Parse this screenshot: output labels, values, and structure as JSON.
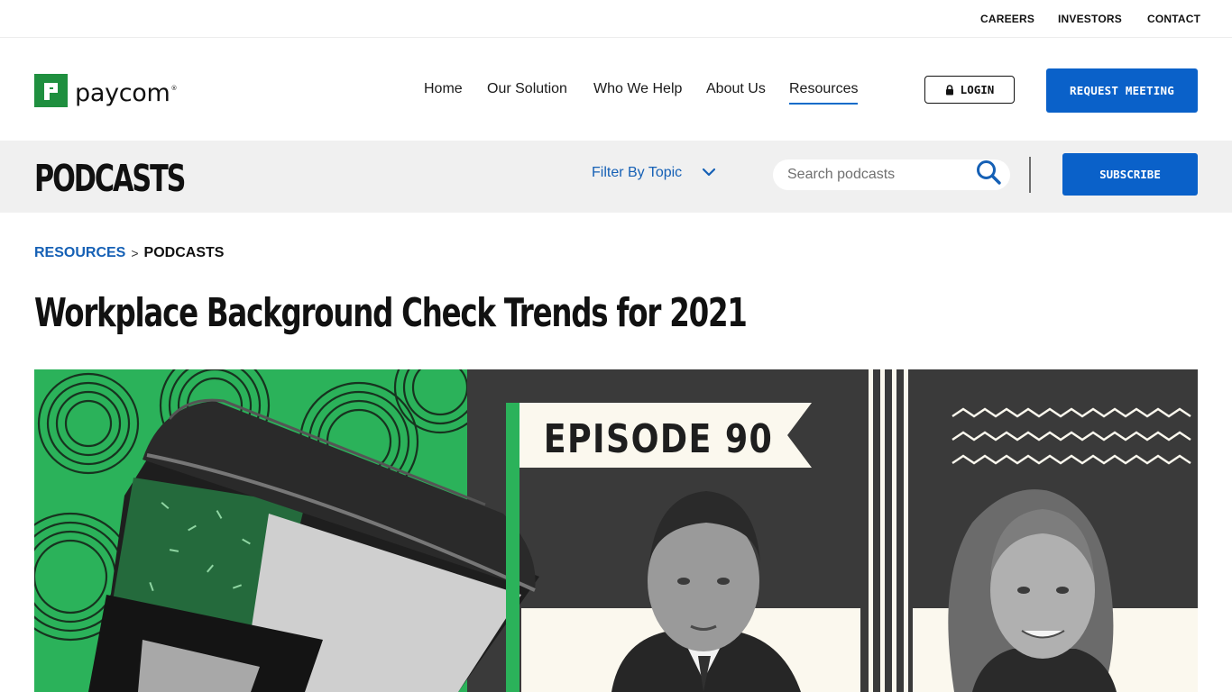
{
  "utility_nav": [
    {
      "label": "CAREERS"
    },
    {
      "label": "INVESTORS"
    },
    {
      "label": "CONTACT"
    }
  ],
  "brand": {
    "name": "paycom",
    "registered": "®",
    "color": "#1f8f3f"
  },
  "main_nav": [
    {
      "label": "Home",
      "active": false
    },
    {
      "label": "Our Solution",
      "active": false
    },
    {
      "label": "Who We Help",
      "active": false
    },
    {
      "label": "About Us",
      "active": false
    },
    {
      "label": "Resources",
      "active": true
    }
  ],
  "login": {
    "label": "LOGIN",
    "icon": "lock-icon"
  },
  "request_meeting": {
    "label": "REQUEST MEETING"
  },
  "podcast_bar": {
    "title": "PODCASTS",
    "filter_label": "Filter By Topic",
    "search_placeholder": "Search podcasts",
    "subscribe_label": "SUBSCRIBE"
  },
  "breadcrumb": {
    "parent": "RESOURCES",
    "separator": ">",
    "current": "PODCASTS"
  },
  "article": {
    "title": "Workplace Background Check Trends for 2021"
  },
  "hero": {
    "episode_label": "EPISODE 90"
  },
  "colors": {
    "accent_blue": "#0a61c9",
    "link_blue": "#1560b5",
    "brand_green": "#1f8f3f",
    "hero_dark": "#3a3a3a",
    "hero_green": "#2bb25a"
  }
}
